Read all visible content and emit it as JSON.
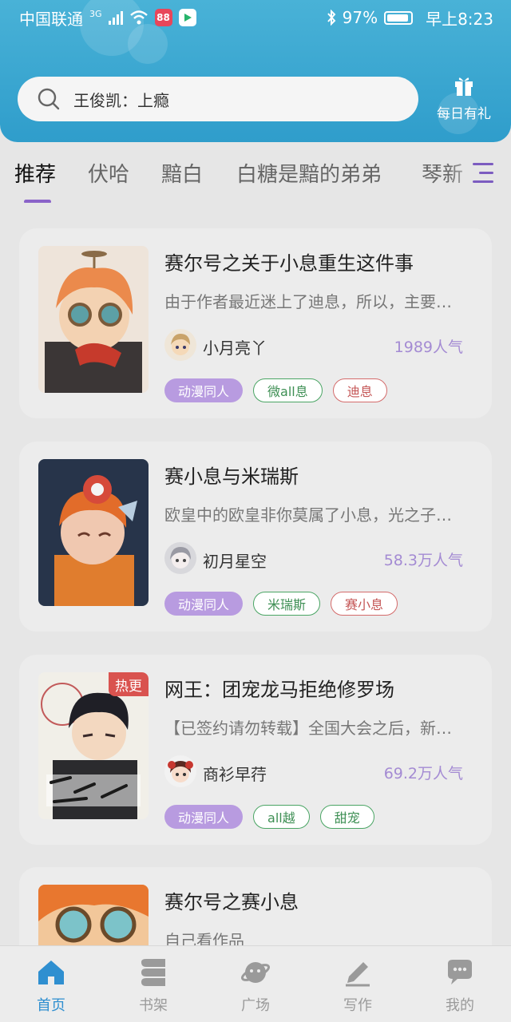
{
  "status_bar": {
    "carrier": "中国联通",
    "network": "3G",
    "battery": "97%",
    "time": "早上8:23"
  },
  "search": {
    "value": "王俊凯：上瘾"
  },
  "gift": {
    "label": "每日有礼"
  },
  "tabs": [
    {
      "label": "推荐",
      "active": true
    },
    {
      "label": "伏哈"
    },
    {
      "label": "黯白"
    },
    {
      "label": "白糖是黯的弟弟"
    },
    {
      "label": "琴新"
    }
  ],
  "books": [
    {
      "title": "赛尔号之关于小息重生这件事",
      "desc": "由于作者最近迷上了迪息，所以，主要…",
      "author": "小月亮丫",
      "popularity": "1989人气",
      "tags": [
        {
          "label": "动漫同人",
          "style": "purple"
        },
        {
          "label": "微all息",
          "style": "green"
        },
        {
          "label": "迪息",
          "style": "red"
        }
      ]
    },
    {
      "title": "赛小息与米瑞斯",
      "desc": "欧皇中的欧皇非你莫属了小息，光之子…",
      "author": "初月星空",
      "popularity": "58.3万人气",
      "tags": [
        {
          "label": "动漫同人",
          "style": "purple"
        },
        {
          "label": "米瑞斯",
          "style": "green"
        },
        {
          "label": "赛小息",
          "style": "red"
        }
      ]
    },
    {
      "title": "网王：团宠龙马拒绝修罗场",
      "desc": "【已签约请勿转载】全国大会之后，新…",
      "author": "商衫早荇",
      "popularity": "69.2万人气",
      "badge": "热更",
      "tags": [
        {
          "label": "动漫同人",
          "style": "purple"
        },
        {
          "label": "all越",
          "style": "green"
        },
        {
          "label": "甜宠",
          "style": "green"
        }
      ]
    },
    {
      "title": "赛尔号之赛小息",
      "desc": "自己看作品"
    }
  ],
  "bottom_nav": [
    {
      "label": "首页",
      "icon": "home-icon",
      "active": true
    },
    {
      "label": "书架",
      "icon": "bookshelf-icon"
    },
    {
      "label": "广场",
      "icon": "planet-icon"
    },
    {
      "label": "写作",
      "icon": "pen-icon"
    },
    {
      "label": "我的",
      "icon": "chat-bubble-icon"
    }
  ],
  "colors": {
    "header": "#2f9dcb",
    "accent": "#8a63c9",
    "tag_purple": "#b89be0",
    "tag_green": "#4aa564",
    "tag_red": "#d46b6b",
    "nav_active": "#2f8fd0"
  }
}
